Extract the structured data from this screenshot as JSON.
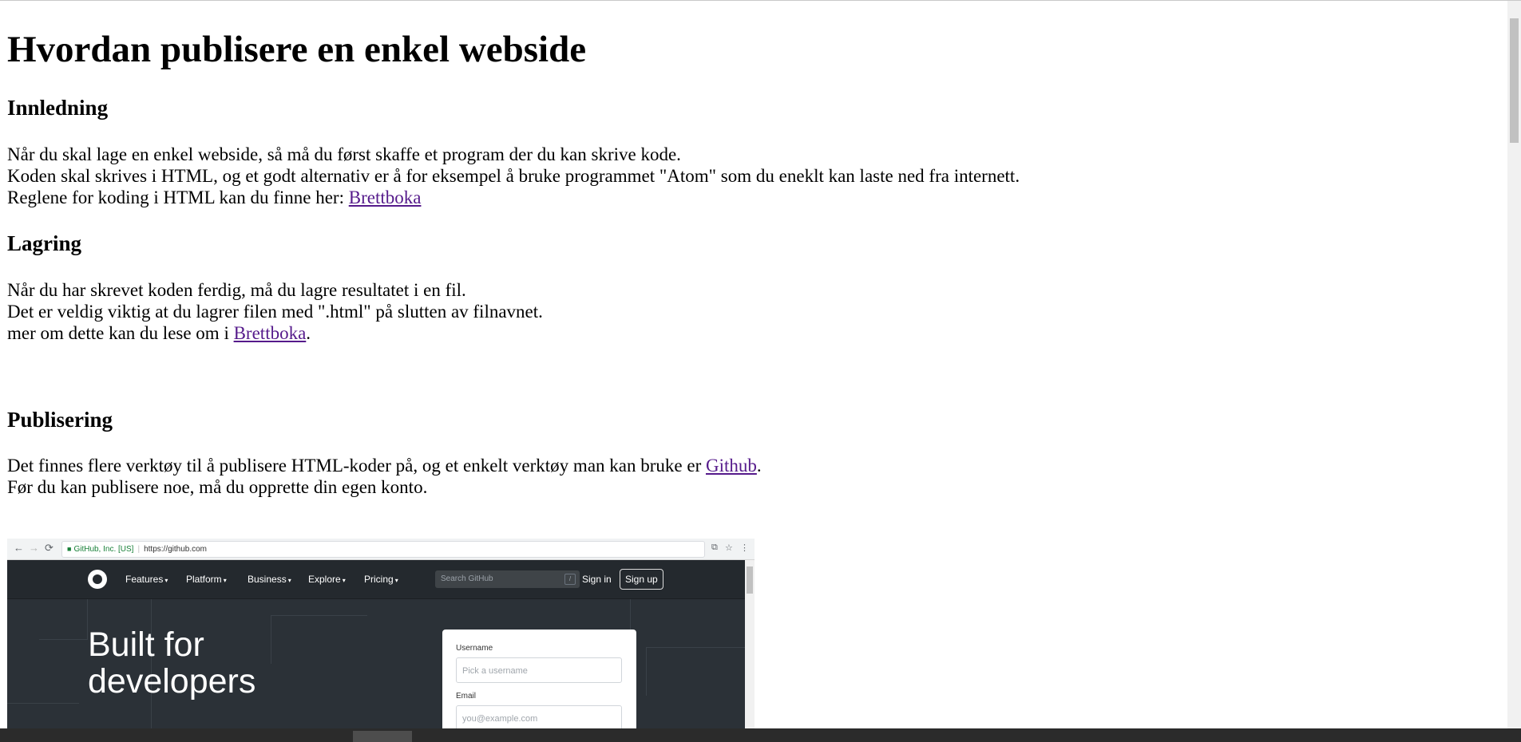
{
  "article": {
    "title": "Hvordan publisere en enkel webside",
    "sections": [
      {
        "heading": "Innledning",
        "lines": [
          "Når du skal lage en enkel webside, så må du først skaffe et program der du kan skrive kode.",
          "Koden skal skrives i HTML, og et godt alternativ er å for eksempel å bruke programmet \"Atom\" som du eneklt kan laste ned fra internett."
        ],
        "link_line": {
          "before": "Reglene for koding i HTML kan du finne her: ",
          "link": "Brettboka",
          "after": ""
        }
      },
      {
        "heading": "Lagring",
        "lines": [
          "Når du har skrevet koden ferdig, må du lagre resultatet i en fil.",
          "Det er veldig viktig at du lagrer filen med \".html\" på slutten av filnavnet."
        ],
        "link_line": {
          "before": "mer om dette kan du lese om i ",
          "link": "Brettboka",
          "after": "."
        }
      },
      {
        "heading": "Publisering",
        "link_line": {
          "before": "Det finnes flere verktøy til å publisere HTML-koder på, og et enkelt verktøy man kan bruke er ",
          "link": "Github",
          "after": "."
        },
        "lines": [
          "Før du kan publisere noe, må du opprette din egen konto."
        ]
      }
    ]
  },
  "screenshot": {
    "browser": {
      "nav_back": "←",
      "nav_forward": "→",
      "reload": "⟳",
      "site_identity": "GitHub, Inc. [US]",
      "url": "https://github.com",
      "translate_icon": "⧉",
      "star_icon": "☆",
      "menu_icon": "⋮"
    },
    "github": {
      "menu": [
        "Features",
        "Platform",
        "Business",
        "Explore",
        "Pricing"
      ],
      "search_placeholder": "Search GitHub",
      "search_key": "/",
      "sign_in": "Sign in",
      "sign_up": "Sign up",
      "hero_line1": "Built for",
      "hero_line2": "developers",
      "form": {
        "username_label": "Username",
        "username_placeholder": "Pick a username",
        "email_label": "Email",
        "email_placeholder": "you@example.com"
      }
    }
  }
}
